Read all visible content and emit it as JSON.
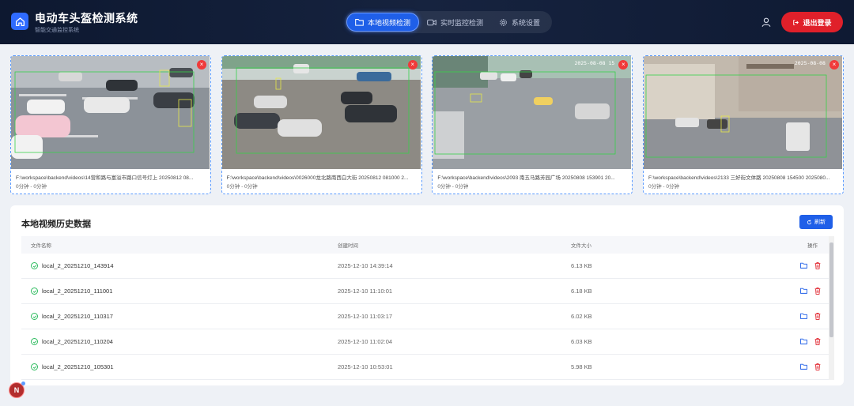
{
  "header": {
    "title": "电动车头盔检测系统",
    "subtitle": "智能交通监控系统",
    "logo_icon": "home-icon",
    "nav": [
      {
        "label": "本地视频检测",
        "icon": "folder-icon",
        "active": true
      },
      {
        "label": "实时监控检测",
        "icon": "video-camera-icon",
        "active": false
      },
      {
        "label": "系统设置",
        "icon": "gear-icon",
        "active": false
      }
    ],
    "logout_label": "退出登录"
  },
  "videos": [
    {
      "path": "F:\\workspace\\backend\\videos\\14营和路与富溢市路口信号灯上 20250812 08...",
      "duration": "0分钟 - 0分钟",
      "timestamp": ""
    },
    {
      "path": "F:\\workspace\\backend\\videos\\0026000龙北路南西白大街 20250812 081000 2...",
      "duration": "0分钟 - 0分钟",
      "timestamp": ""
    },
    {
      "path": "F:\\workspace\\backend\\videos\\2093 南五马路芳园广场 20250808 153901 20...",
      "duration": "0分钟 - 0分钟",
      "timestamp": "2025-08-08 15"
    },
    {
      "path": "F:\\workspace\\backend\\videos\\2133 三好街文体路 20250808 154500 2025080...",
      "duration": "0分钟 - 0分钟",
      "timestamp": "2025-08-08"
    }
  ],
  "history": {
    "title": "本地视频历史数据",
    "refresh_label": "刷新",
    "columns": {
      "name": "文件名称",
      "time": "创建时间",
      "size": "文件大小",
      "ops": "操作"
    },
    "rows": [
      {
        "name": "local_2_20251210_143914",
        "time": "2025-12-10 14:39:14",
        "size": "6.13 KB"
      },
      {
        "name": "local_2_20251210_111001",
        "time": "2025-12-10 11:10:01",
        "size": "6.18 KB"
      },
      {
        "name": "local_2_20251210_110317",
        "time": "2025-12-10 11:03:17",
        "size": "6.02 KB"
      },
      {
        "name": "local_2_20251210_110204",
        "time": "2025-12-10 11:02:04",
        "size": "6.03 KB"
      },
      {
        "name": "local_2_20251210_105301",
        "time": "2025-12-10 10:53:01",
        "size": "5.98 KB"
      }
    ]
  },
  "float_badge": "N",
  "colors": {
    "primary": "#1f5fe8",
    "danger": "#e0202a",
    "header_bg": "#0d1830",
    "success": "#2dbb5e"
  }
}
